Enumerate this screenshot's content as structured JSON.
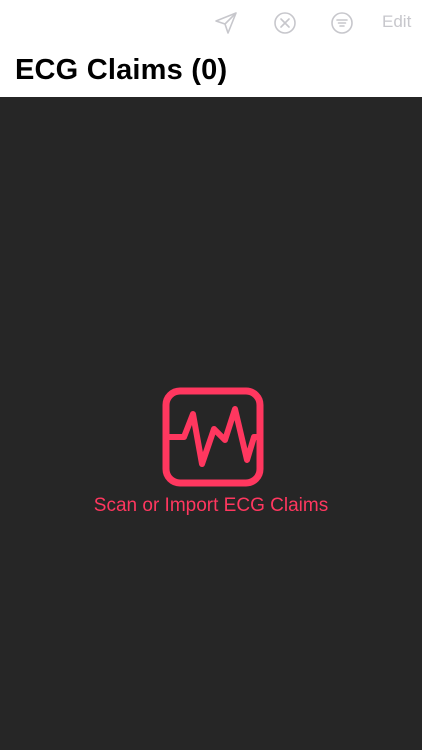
{
  "header": {
    "title": "ECG Claims (0)",
    "edit_label": "Edit",
    "icons": [
      "send-icon",
      "clear-icon",
      "filter-icon"
    ]
  },
  "empty_state": {
    "icon": "ecg-waveform-icon",
    "message": "Scan or Import ECG Claims"
  },
  "colors": {
    "accent": "#ff375f",
    "toolbar_inactive": "#c7c7cc",
    "content_background": "#262626",
    "header_background": "#ffffff"
  }
}
